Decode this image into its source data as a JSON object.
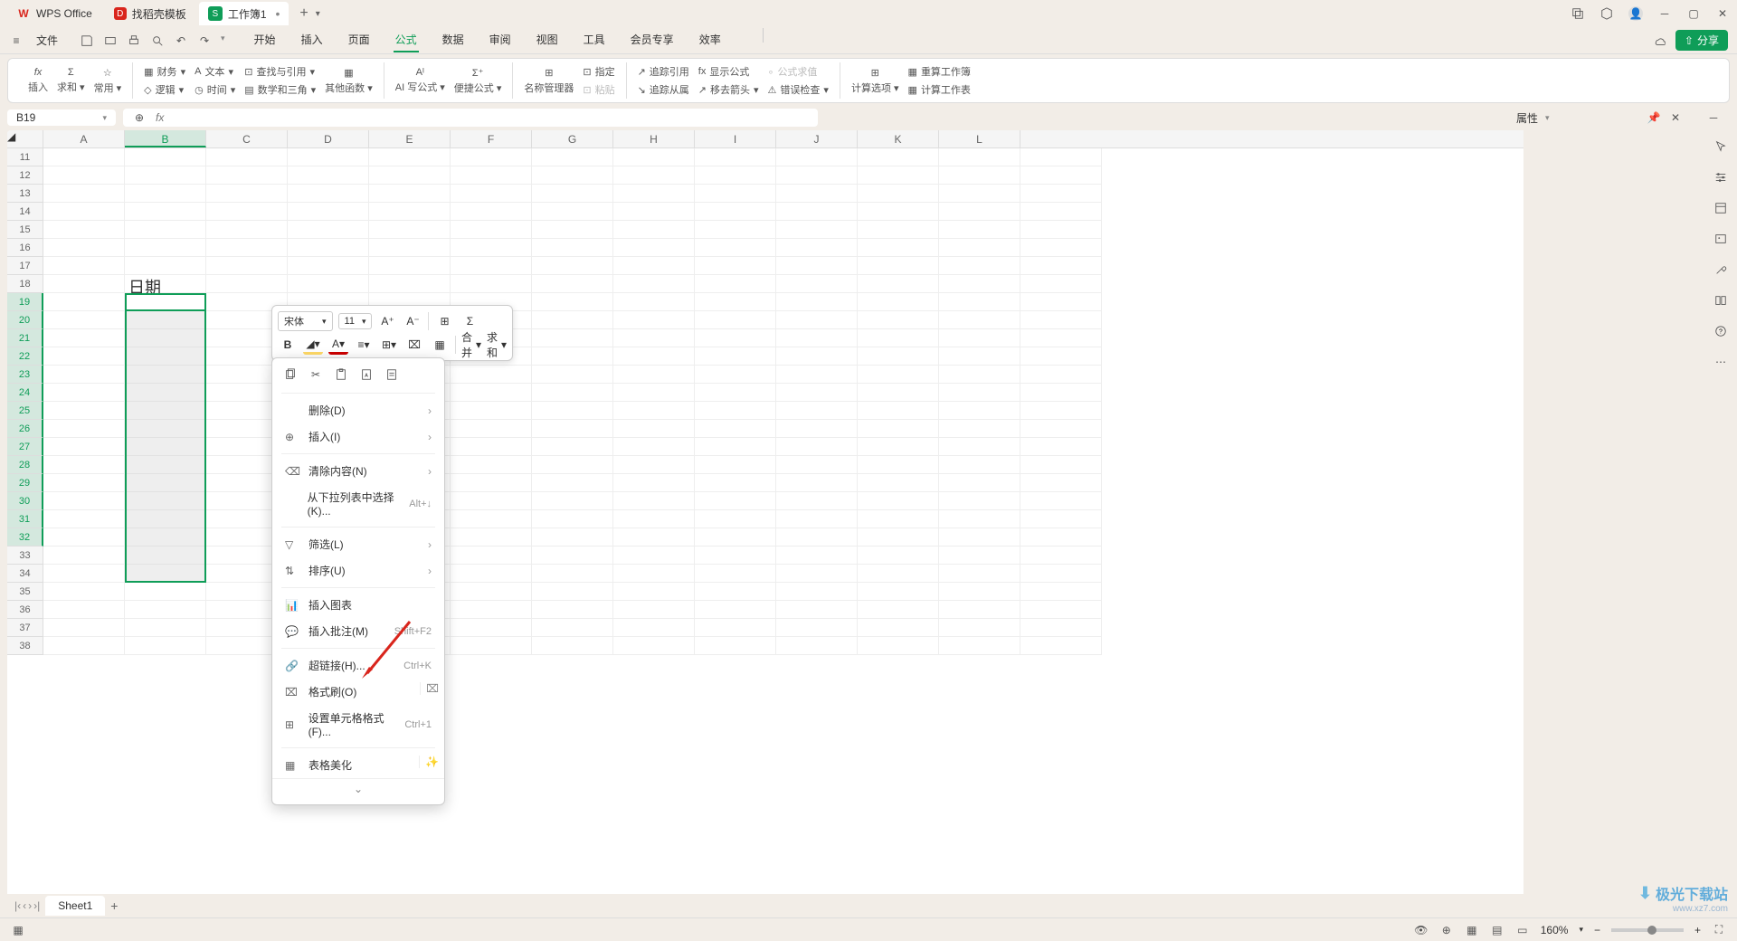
{
  "titlebar": {
    "app": "WPS Office",
    "tab_templates": "找稻壳模板",
    "active_tab": "工作簿1"
  },
  "menubar": {
    "file": "文件",
    "tabs": [
      "开始",
      "插入",
      "页面",
      "公式",
      "数据",
      "审阅",
      "视图",
      "工具",
      "会员专享",
      "效率"
    ],
    "active_tab": "公式",
    "share": "分享"
  },
  "ribbon": {
    "insert": "插入",
    "sum": "求和",
    "common": "常用",
    "finance": "财务",
    "text": "文本",
    "lookup": "查找与引用",
    "logic": "逻辑",
    "time": "时间",
    "math": "数学和三角",
    "other": "其他函数",
    "ai_formula": "AI 写公式",
    "quick_formula": "便捷公式",
    "name_mgr": "名称管理器",
    "specify": "指定",
    "paste": "粘贴",
    "trace_ref": "追踪引用",
    "show_formula": "显示公式",
    "formula_eval": "公式求值",
    "trace_dep": "追踪从属",
    "move_arrow": "移去箭头",
    "error_check": "错误检查",
    "calc_opt": "计算选项",
    "recalc": "重算工作簿",
    "calc_sheet": "计算工作表"
  },
  "namebox": {
    "value": "B19"
  },
  "cols": [
    "A",
    "B",
    "C",
    "D",
    "E",
    "F",
    "G",
    "H",
    "I",
    "J",
    "K",
    "L"
  ],
  "rows_start": 11,
  "rows_end": 38,
  "cell_b18": "日期",
  "right_panel": {
    "title": "属性"
  },
  "mini": {
    "font": "宋体",
    "size": "11",
    "merge": "合并",
    "sum": "求和"
  },
  "context": {
    "delete": "删除(D)",
    "insert": "插入(I)",
    "clear": "清除内容(N)",
    "dropdown": "从下拉列表中选择(K)...",
    "dropdown_sc": "Alt+↓",
    "filter": "筛选(L)",
    "sort": "排序(U)",
    "chart": "插入图表",
    "comment": "插入批注(M)",
    "comment_sc": "Shift+F2",
    "hyperlink": "超链接(H)...",
    "hyperlink_sc": "Ctrl+K",
    "format_painter": "格式刷(O)",
    "format_cells": "设置单元格格式(F)...",
    "format_cells_sc": "Ctrl+1",
    "beautify": "表格美化"
  },
  "sheets": {
    "name": "Sheet1"
  },
  "statusbar": {
    "zoom": "160%"
  },
  "watermark": {
    "name": "极光下载站",
    "url": "www.xz7.com"
  }
}
